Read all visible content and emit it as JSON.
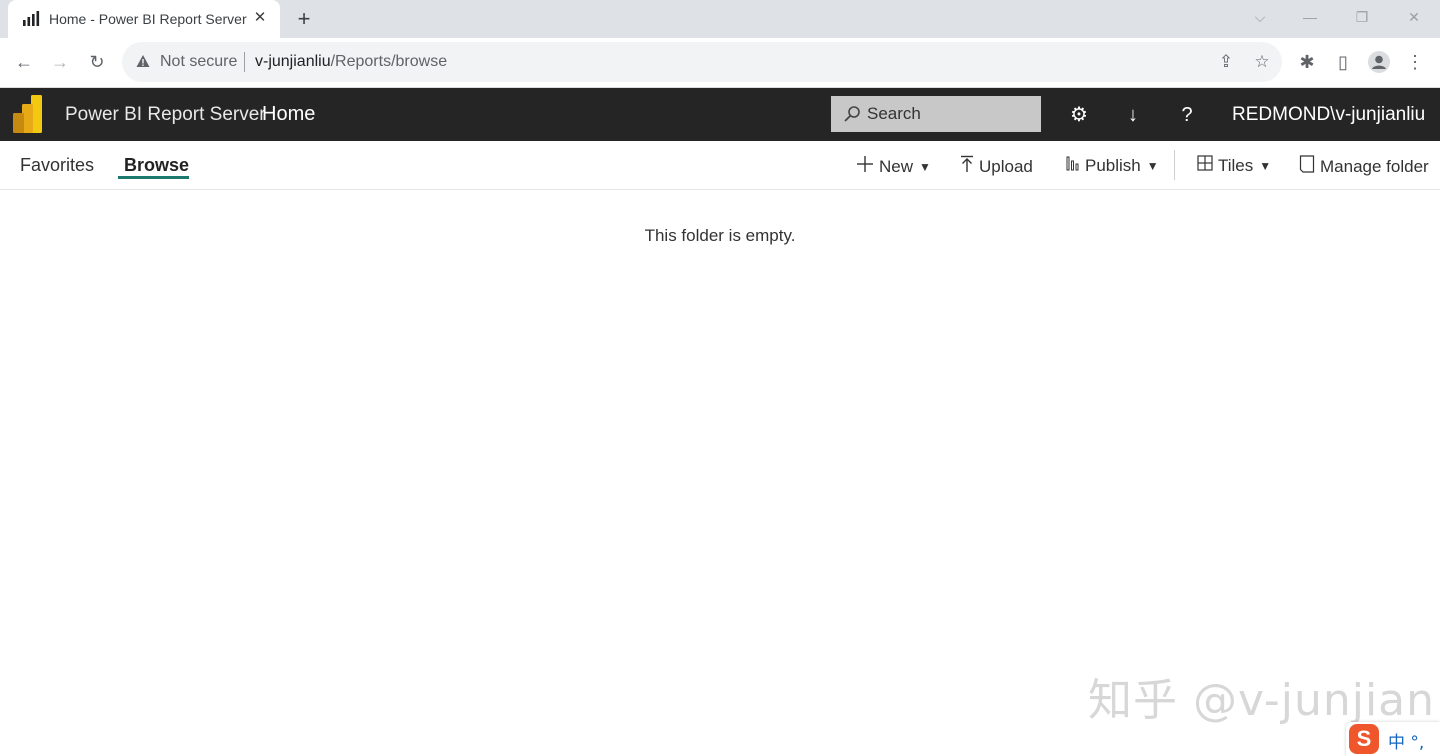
{
  "browser": {
    "tab_title": "Home - Power BI Report Server",
    "security_label": "Not secure",
    "url_host": "v-junjianliu",
    "url_path": "/Reports/browse"
  },
  "header": {
    "product_name": "Power BI Report Server",
    "page_title": "Home",
    "search_placeholder": "Search",
    "user": "REDMOND\\v-junjianliu",
    "bar_color": "#252525"
  },
  "subnav": {
    "tabs": [
      {
        "label": "Favorites",
        "active": false
      },
      {
        "label": "Browse",
        "active": true
      }
    ],
    "commands": {
      "new_label": "New",
      "upload_label": "Upload",
      "publish_label": "Publish",
      "view_label": "Tiles",
      "manage_label": "Manage folder"
    },
    "accent_color": "#1b7a6d"
  },
  "main": {
    "empty_message": "This folder is empty."
  },
  "watermark": "知乎 @v-junjian",
  "ime": {
    "logo": "S",
    "mode": "中 °,"
  },
  "icons": [
    "bar-chart-favicon",
    "close-icon",
    "plus-icon",
    "back-icon",
    "forward-icon",
    "reload-icon",
    "warning-icon",
    "share-icon",
    "star-icon",
    "puzzle-icon",
    "sidepanel-icon",
    "profile-icon",
    "menu-icon",
    "powerbi-logo",
    "search-icon",
    "gear-icon",
    "download-icon",
    "help-icon",
    "upload-icon",
    "publish-icon",
    "tiles-icon",
    "manage-folder-icon"
  ]
}
